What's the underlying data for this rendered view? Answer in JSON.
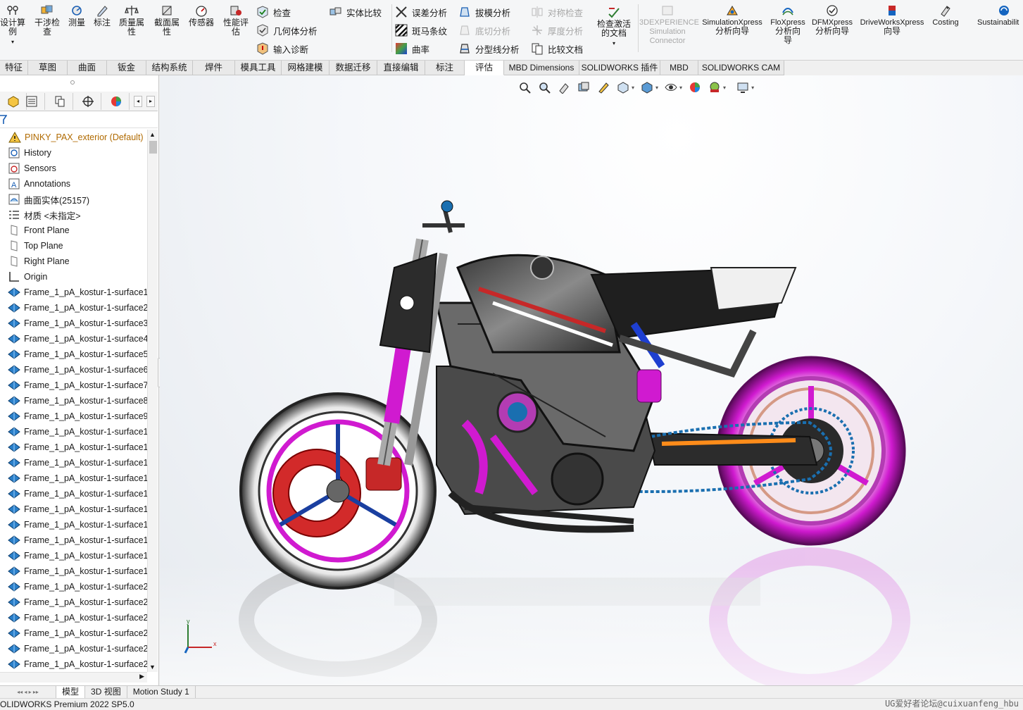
{
  "ribbon": {
    "big_buttons": [
      {
        "name": "design-study-button",
        "label": "设计算例",
        "lines": [
          "设计算",
          "例"
        ],
        "has_dropdown": true,
        "icon": "design-study-icon"
      },
      {
        "name": "interference-check-button",
        "label": "干涉检查",
        "lines": [
          "干涉检",
          "查"
        ],
        "icon": "interference-icon"
      },
      {
        "name": "measure-button",
        "label": "测量",
        "lines": [
          "测量"
        ],
        "icon": "measure-icon"
      },
      {
        "name": "markup-button",
        "label": "标注",
        "lines": [
          "标注"
        ],
        "icon": "markup-icon"
      },
      {
        "name": "mass-properties-button",
        "label": "质量属性",
        "lines": [
          "质量属",
          "性"
        ],
        "icon": "mass-properties-icon"
      },
      {
        "name": "section-properties-button",
        "label": "截面属性",
        "lines": [
          "截面属",
          "性"
        ],
        "icon": "section-properties-icon"
      },
      {
        "name": "sensor-button",
        "label": "传感器",
        "lines": [
          "传感器"
        ],
        "icon": "sensor-icon"
      },
      {
        "name": "performance-evaluation-button",
        "label": "性能评估",
        "lines": [
          "性能评",
          "估"
        ],
        "icon": "performance-icon"
      }
    ],
    "small_buttons": [
      {
        "name": "check-button",
        "label": "检查",
        "icon": "check-icon",
        "enabled": true
      },
      {
        "name": "geometry-analysis-button",
        "label": "几何体分析",
        "icon": "geometry-analysis-icon",
        "enabled": true
      },
      {
        "name": "import-diagnostics-button",
        "label": "输入诊断",
        "icon": "import-diagnostics-icon",
        "enabled": true
      },
      {
        "name": "compare-bodies-button",
        "label": "实体比较",
        "icon": "compare-bodies-icon",
        "enabled": true
      },
      {
        "name": "deviation-analysis-button",
        "label": "误差分析",
        "icon": "deviation-icon",
        "enabled": true
      },
      {
        "name": "zebra-stripes-button",
        "label": "斑马条纹",
        "icon": "zebra-icon",
        "enabled": true
      },
      {
        "name": "curvature-button",
        "label": "曲率",
        "icon": "curvature-icon",
        "enabled": true
      },
      {
        "name": "draft-analysis-button",
        "label": "拔模分析",
        "icon": "draft-icon",
        "enabled": true
      },
      {
        "name": "undercut-analysis-button",
        "label": "底切分析",
        "icon": "undercut-icon",
        "enabled": false
      },
      {
        "name": "parting-line-analysis-button",
        "label": "分型线分析",
        "icon": "parting-line-icon",
        "enabled": true
      },
      {
        "name": "symmetry-check-button",
        "label": "对称检查",
        "icon": "symmetry-icon",
        "enabled": false
      },
      {
        "name": "thickness-analysis-button",
        "label": "厚度分析",
        "icon": "thickness-icon",
        "enabled": false
      },
      {
        "name": "compare-documents-button",
        "label": "比较文档",
        "icon": "compare-documents-icon",
        "enabled": true
      }
    ],
    "check_active_doc": {
      "label": "检查激活的文档",
      "lines": [
        "检查激活",
        "的文档"
      ]
    },
    "addins": [
      {
        "name": "3dexperience-simulation-connector-button",
        "lines": [
          "3DEXPERIENCE",
          "Simulation",
          "Connector"
        ],
        "enabled": false,
        "icon": "3dexperience-icon"
      },
      {
        "name": "simulationxpress-button",
        "lines": [
          "SimulationXpress",
          "分析向导"
        ],
        "enabled": true,
        "icon": "simulationxpress-icon"
      },
      {
        "name": "floxpress-button",
        "lines": [
          "FloXpress",
          "分析向",
          "导"
        ],
        "enabled": true,
        "icon": "floxpress-icon"
      },
      {
        "name": "dfmxpress-button",
        "lines": [
          "DFMXpress",
          "分析向导"
        ],
        "enabled": true,
        "icon": "dfmxpress-icon"
      },
      {
        "name": "driveworksxpress-button",
        "lines": [
          "DriveWorksXpress",
          "向导"
        ],
        "enabled": true,
        "icon": "driveworksxpress-icon"
      },
      {
        "name": "costing-button",
        "lines": [
          "Costing"
        ],
        "enabled": true,
        "icon": "costing-icon"
      },
      {
        "name": "sustainability-button",
        "lines": [
          "Sustainabilit"
        ],
        "enabled": true,
        "icon": "sustainability-icon"
      }
    ]
  },
  "tabs": [
    {
      "label": "特征",
      "w": 40
    },
    {
      "label": "草图",
      "w": 56
    },
    {
      "label": "曲面",
      "w": 56
    },
    {
      "label": "钣金",
      "w": 56
    },
    {
      "label": "结构系统",
      "w": 66
    },
    {
      "label": "焊件",
      "w": 60
    },
    {
      "label": "模具工具",
      "w": 66
    },
    {
      "label": "网格建模",
      "w": 68
    },
    {
      "label": "数据迁移",
      "w": 68
    },
    {
      "label": "直接编辑",
      "w": 68
    },
    {
      "label": "标注",
      "w": 56
    },
    {
      "label": "评估",
      "w": 56,
      "active": true
    },
    {
      "label": "MBD Dimensions",
      "w": 107,
      "en": true
    },
    {
      "label": "SOLIDWORKS 插件",
      "w": 115,
      "en": true
    },
    {
      "label": "MBD",
      "w": 54,
      "en": true
    },
    {
      "label": "SOLIDWORKS CAM",
      "w": 122,
      "en": true
    }
  ],
  "feature_manager": {
    "root": "PINKY_PAX_exterior  (Default)",
    "items": [
      {
        "label": "History",
        "icon": "history-icon"
      },
      {
        "label": "Sensors",
        "icon": "sensors-icon"
      },
      {
        "label": "Annotations",
        "icon": "annotations-icon"
      },
      {
        "label": "曲面实体(25157)",
        "icon": "surface-bodies-icon"
      },
      {
        "label": "材质 <未指定>",
        "icon": "material-icon"
      },
      {
        "label": "Front Plane",
        "icon": "plane-icon"
      },
      {
        "label": "Top Plane",
        "icon": "plane-icon"
      },
      {
        "label": "Right Plane",
        "icon": "plane-icon"
      },
      {
        "label": "Origin",
        "icon": "origin-icon"
      },
      {
        "label": "Frame_1_pA_kostur-1-surface1",
        "icon": "imported-surface-icon"
      },
      {
        "label": "Frame_1_pA_kostur-1-surface2",
        "icon": "imported-surface-icon"
      },
      {
        "label": "Frame_1_pA_kostur-1-surface3",
        "icon": "imported-surface-icon"
      },
      {
        "label": "Frame_1_pA_kostur-1-surface4",
        "icon": "imported-surface-icon"
      },
      {
        "label": "Frame_1_pA_kostur-1-surface5",
        "icon": "imported-surface-icon"
      },
      {
        "label": "Frame_1_pA_kostur-1-surface6",
        "icon": "imported-surface-icon"
      },
      {
        "label": "Frame_1_pA_kostur-1-surface7",
        "icon": "imported-surface-icon"
      },
      {
        "label": "Frame_1_pA_kostur-1-surface8",
        "icon": "imported-surface-icon"
      },
      {
        "label": "Frame_1_pA_kostur-1-surface9",
        "icon": "imported-surface-icon"
      },
      {
        "label": "Frame_1_pA_kostur-1-surface1",
        "icon": "imported-surface-icon"
      },
      {
        "label": "Frame_1_pA_kostur-1-surface1",
        "icon": "imported-surface-icon"
      },
      {
        "label": "Frame_1_pA_kostur-1-surface1",
        "icon": "imported-surface-icon"
      },
      {
        "label": "Frame_1_pA_kostur-1-surface1",
        "icon": "imported-surface-icon"
      },
      {
        "label": "Frame_1_pA_kostur-1-surface1",
        "icon": "imported-surface-icon"
      },
      {
        "label": "Frame_1_pA_kostur-1-surface1",
        "icon": "imported-surface-icon"
      },
      {
        "label": "Frame_1_pA_kostur-1-surface1",
        "icon": "imported-surface-icon"
      },
      {
        "label": "Frame_1_pA_kostur-1-surface1",
        "icon": "imported-surface-icon"
      },
      {
        "label": "Frame_1_pA_kostur-1-surface1",
        "icon": "imported-surface-icon"
      },
      {
        "label": "Frame_1_pA_kostur-1-surface1",
        "icon": "imported-surface-icon"
      },
      {
        "label": "Frame_1_pA_kostur-1-surface2",
        "icon": "imported-surface-icon"
      },
      {
        "label": "Frame_1_pA_kostur-1-surface2",
        "icon": "imported-surface-icon"
      },
      {
        "label": "Frame_1_pA_kostur-1-surface2",
        "icon": "imported-surface-icon"
      },
      {
        "label": "Frame_1_pA_kostur-1-surface2",
        "icon": "imported-surface-icon"
      },
      {
        "label": "Frame_1_pA_kostur-1-surface2",
        "icon": "imported-surface-icon"
      },
      {
        "label": "Frame_1_pA_kostur-1-surface2",
        "icon": "imported-surface-icon"
      }
    ]
  },
  "triad": {
    "x": "x",
    "y": "y"
  },
  "bottom_tabs": [
    {
      "label": "模型",
      "active": true
    },
    {
      "label": "3D 视图"
    },
    {
      "label": "Motion Study 1"
    }
  ],
  "status_text": "OLIDWORKS Premium 2022 SP5.0",
  "watermark": "UG爱好者论坛@cuixuanfeng_hbu",
  "colors": {
    "accent": "#1a5fb4",
    "warning": "#e8a800",
    "magenta": "#d01ad0",
    "surface_blue": "#2a7fc9"
  }
}
